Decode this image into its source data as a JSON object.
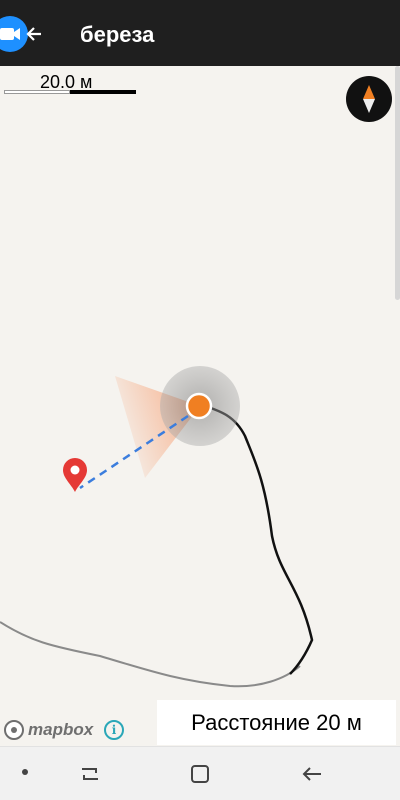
{
  "header": {
    "title": "береза",
    "back_icon": "arrow-left-icon",
    "recording_icon": "video-camera-icon",
    "background": "#1f1f1f"
  },
  "map": {
    "scale_label": "20.0 м",
    "compass_icon": "compass-icon",
    "attribution": "mapbox",
    "info_icon": "info-icon",
    "background": "#f5f3ef",
    "accent_location": "#f07f22",
    "marker_color": "#e53935",
    "route_color": "#3b7ddd"
  },
  "distance": {
    "text": "Расстояние 20 м"
  },
  "navbar": {
    "recent_icon": "recent-apps-icon",
    "home_icon": "home-icon",
    "back_icon": "back-icon"
  }
}
